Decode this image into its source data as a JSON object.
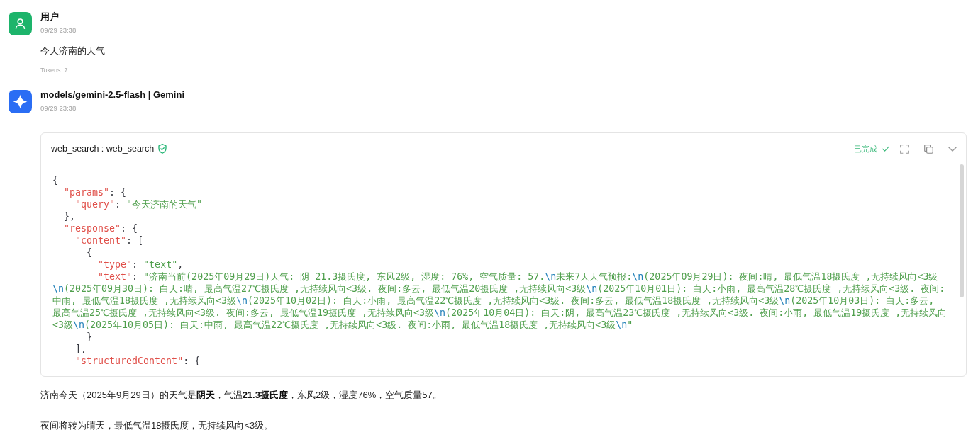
{
  "messages": [
    {
      "kind": "user",
      "author": "用户",
      "time": "09/29 23:38",
      "text": "今天济南的天气",
      "tokens": "Tokens: 7"
    },
    {
      "kind": "assistant",
      "author": "models/gemini-2.5-flash | Gemini",
      "time": "09/29 23:38",
      "tool_call": {
        "title": "web_search : web_search",
        "verified": true,
        "status": "已完成",
        "completed": true,
        "expanded": true,
        "code_lines": [
          "{",
          "  \"params\": {",
          "    \"query\": \"今天济南的天气\"",
          "  },",
          "  \"response\": {",
          "    \"content\": [",
          "      {",
          "        \"type\": \"text\",",
          "        \"text\": \"济南当前(2025年09月29日)天气: 阴 21.3摄氏度, 东风2级, 湿度: 76%, 空气质量: 57.\\n未来7天天气预报:\\n(2025年09月29日): 夜间:晴, 最低气温18摄氏度 ,无持续风向<3级\\n(2025年09月30日): 白天:晴, 最高气温27℃摄氏度 ,无持续风向<3级. 夜间:多云, 最低气温20摄氏度 ,无持续风向<3级\\n(2025年10月01日): 白天:小雨, 最高气温28℃摄氏度 ,无持续风向<3级. 夜间:中雨, 最低气温18摄氏度 ,无持续风向<3级\\n(2025年10月02日): 白天:小雨, 最高气温22℃摄氏度 ,无持续风向<3级. 夜间:多云, 最低气温18摄氏度 ,无持续风向<3级\\n(2025年10月03日): 白天:多云, 最高气温25℃摄氏度 ,无持续风向<3级. 夜间:多云, 最低气温19摄氏度 ,无持续风向<3级\\n(2025年10月04日): 白天:阴, 最高气温23℃摄氏度 ,无持续风向<3级. 夜间:小雨, 最低气温19摄氏度 ,无持续风向<3级\\n(2025年10月05日): 白天:中雨, 最高气温22℃摄氏度 ,无持续风向<3级. 夜间:小雨, 最低气温18摄氏度 ,无持续风向<3级\\n\"",
          "      }",
          "    ],",
          "    \"structuredContent\": {"
        ]
      },
      "paragraphs": [
        "济南今天（2025年9月29日）的天气是**阴天**，气温**21.3摄氏度**，东风2级，湿度76%，空气质量57。",
        "夜间将转为晴天，最低气温18摄氏度，无持续风向<3级。"
      ]
    }
  ]
}
